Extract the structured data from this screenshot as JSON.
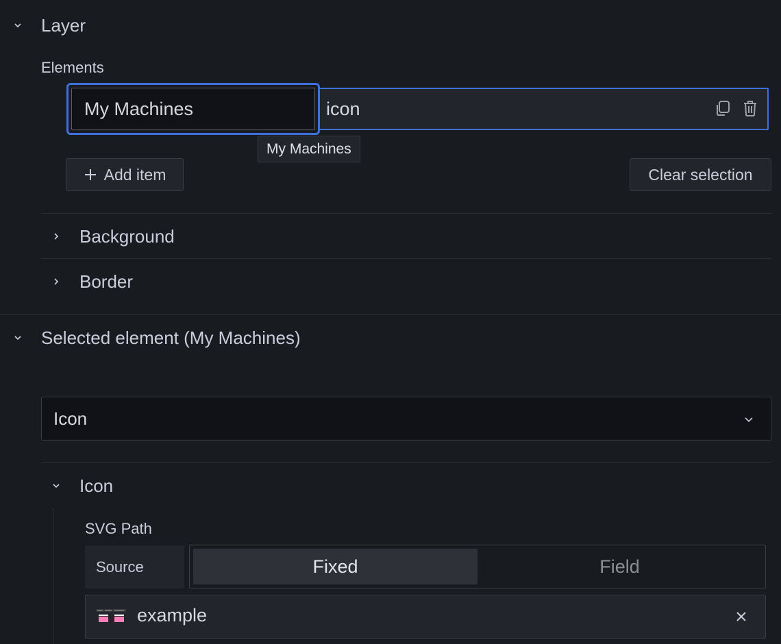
{
  "layer": {
    "title": "Layer",
    "elements_label": "Elements",
    "element_row": {
      "name": "My Machines",
      "type": "icon"
    },
    "tooltip": "My Machines",
    "add_item_label": "Add item",
    "clear_selection_label": "Clear selection",
    "background_label": "Background",
    "border_label": "Border"
  },
  "selected": {
    "title": "Selected element (My Machines)",
    "type_select_value": "Icon",
    "icon_section_title": "Icon",
    "svg_path_label": "SVG Path",
    "source_label": "Source",
    "source_options": [
      "Fixed",
      "Field"
    ],
    "source_selected": "Fixed",
    "icon_value": "example"
  },
  "colors": {
    "background": "#181b1f",
    "accent_blue": "#3d71d9",
    "text": "#ccccdc",
    "muted_text": "#8e8e96",
    "icon_pink": "#ff7eb6"
  }
}
